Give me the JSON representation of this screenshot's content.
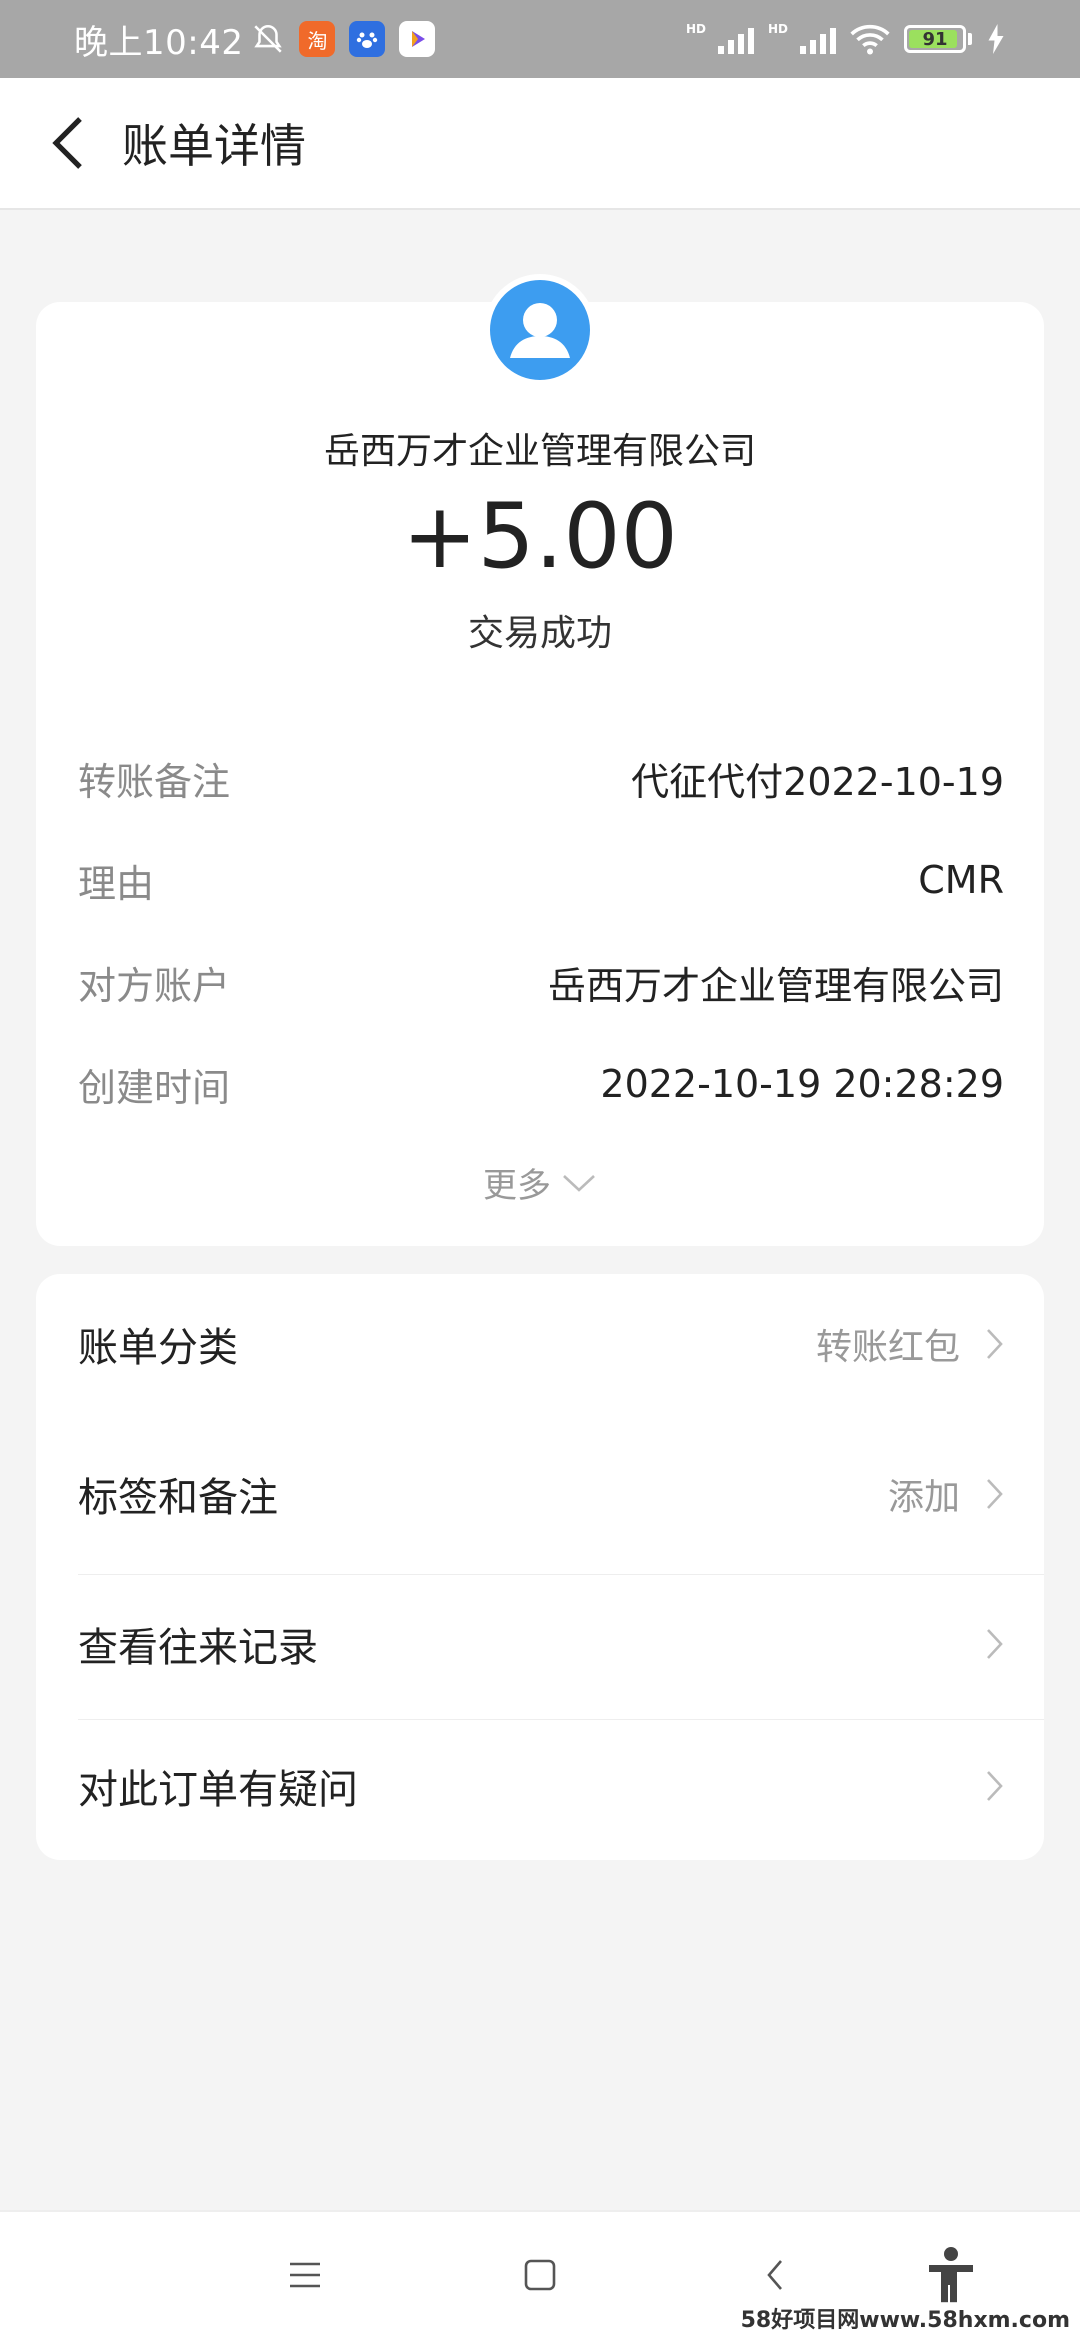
{
  "status_bar": {
    "time": "晚上10:42",
    "battery": "91",
    "hd1": "HD",
    "hd2": "HD"
  },
  "header": {
    "title": "账单详情"
  },
  "transaction": {
    "payer": "岳西万才企业管理有限公司",
    "amount": "+5.00",
    "status": "交易成功"
  },
  "details": [
    {
      "label": "转账备注",
      "value": "代征代付2022-10-19"
    },
    {
      "label": "理由",
      "value": "CMR"
    },
    {
      "label": "对方账户",
      "value": "岳西万才企业管理有限公司"
    },
    {
      "label": "创建时间",
      "value": "2022-10-19 20:28:29"
    }
  ],
  "more_label": "更多",
  "actions": [
    {
      "label": "账单分类",
      "value": "转账红包"
    },
    {
      "label": "标签和备注",
      "value": "添加"
    },
    {
      "label": "查看往来记录",
      "value": ""
    },
    {
      "label": "对此订单有疑问",
      "value": ""
    }
  ],
  "watermark": "58好项目网www.58hxm.com",
  "colors": {
    "status_bar": "#a7a7a7",
    "avatar": "#3d9df0",
    "background": "#f4f4f4"
  }
}
